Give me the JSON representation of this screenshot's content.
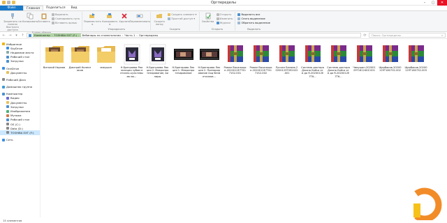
{
  "window": {
    "title": "Оргпеределы"
  },
  "ribbon_tabs": [
    "Файл",
    "Главная",
    "Поделиться",
    "Вид"
  ],
  "ribbon": {
    "clipboard": {
      "label": "Буфер обмена",
      "pin": "Закрепить на панели быстрого доступа",
      "copy": "Копировать",
      "paste": "Вставить",
      "cut": "Вырезать",
      "copy_path": "Скопировать путь",
      "paste_shortcut": "Вставить ярлык"
    },
    "organize": {
      "label": "Упорядочить",
      "move": "Переместить в",
      "copy_to": "Копировать в",
      "delete": "Удалить",
      "rename": "Переименовать"
    },
    "new": {
      "label": "Создать",
      "new_folder": "Создать папку",
      "new_item": "Создать элемент",
      "easy_access": "Простой доступ"
    },
    "open": {
      "label": "Открыть",
      "properties": "Свойства",
      "open": "Открыть",
      "edit": "Изменить",
      "history": "Журнал"
    },
    "select": {
      "label": "Выделить",
      "select_all": "Выделить все",
      "select_none": "Снять выделение",
      "invert": "Обратить выделение"
    }
  },
  "address": {
    "segments": [
      "Компьютер",
      "TOSHIBA EXT (F:)",
      "Вебинары по стоматологии",
      "Часть 1",
      "Оргпеределы"
    ],
    "search_placeholder": "Поиск: Оргпеределы"
  },
  "nav": {
    "items": [
      {
        "label": "Избранное",
        "level": 0,
        "icon": "star-icon"
      },
      {
        "label": "SkyDrive",
        "level": 1,
        "icon": "cloud-icon"
      },
      {
        "label": "Недавние места",
        "level": 1,
        "icon": "recent-icon"
      },
      {
        "label": "Рабочий стол",
        "level": 1,
        "icon": "desktop-icon"
      },
      {
        "label": "Загрузки",
        "level": 1,
        "icon": "download-icon"
      },
      {
        "gap": true
      },
      {
        "label": "OneDrive",
        "level": 0,
        "icon": "cloud-icon"
      },
      {
        "label": "Документы",
        "level": 1,
        "icon": "folder-icon"
      },
      {
        "gap": true
      },
      {
        "label": "Рабочий Диск",
        "level": 0,
        "icon": "drive-icon"
      },
      {
        "gap": true
      },
      {
        "label": "Домашняя группа",
        "level": 0,
        "icon": "homegroup-icon"
      },
      {
        "gap": true
      },
      {
        "label": "Компьютер",
        "level": 0,
        "icon": "computer-icon"
      },
      {
        "label": "Видео",
        "level": 1,
        "icon": "video-icon"
      },
      {
        "label": "Документы",
        "level": 1,
        "icon": "folder-icon"
      },
      {
        "label": "Загрузки",
        "level": 1,
        "icon": "download-icon"
      },
      {
        "label": "Изображения",
        "level": 1,
        "icon": "image-icon"
      },
      {
        "label": "Музыка",
        "level": 1,
        "icon": "music-icon"
      },
      {
        "label": "Рабочий стол",
        "level": 1,
        "icon": "desktop-icon"
      },
      {
        "label": "OS (C:)",
        "level": 1,
        "icon": "drive-icon"
      },
      {
        "label": "Data (D:)",
        "level": 1,
        "icon": "drive-icon"
      },
      {
        "label": "TOSHIBA EXT (F:)",
        "level": 1,
        "icon": "drive-icon",
        "selected": true
      },
      {
        "gap": true
      },
      {
        "label": "Сеть",
        "level": 0,
        "icon": "network-icon"
      }
    ]
  },
  "files": [
    {
      "name": "Виталий Наумов",
      "type": "folder-photo"
    },
    {
      "name": "Дмитрий Колесников",
      "type": "folder-photo"
    },
    {
      "name": "чмеушин",
      "type": "folder"
    },
    {
      "name": "Н.Бреграева Реализация зубов металло-культевыми вк...",
      "type": "mp4"
    },
    {
      "name": "Н.Бреграева Лекция 2. Микропротезирование, виниры",
      "type": "mp4"
    },
    {
      "name": "Н.Брегерова Лекция 1. Микропротезирование",
      "type": "video"
    },
    {
      "name": "Н.Брегерова Лекция 2. Препарирование под безметаллов...",
      "type": "video"
    },
    {
      "name": "Роман Василишин-2020012E7T4171S2-001",
      "type": "rar"
    },
    {
      "name": "Роман Василишин-2020012E7T4171S2-002",
      "type": "rar"
    },
    {
      "name": "Руслан Беляев-20200129T092022-001",
      "type": "rar"
    },
    {
      "name": "Система доктора Джона Койса от А до Я-2020012E7T6...",
      "type": "rar"
    },
    {
      "name": "Система доктора Джона Койса от А до Я-2020012E7T6...",
      "type": "rar"
    },
    {
      "name": "Чмеушин-20200129T161240Z-001",
      "type": "rar"
    },
    {
      "name": "Щербаков-20200129T180732-002",
      "type": "rar"
    },
    {
      "name": "Щербаков-20200129T180732-003",
      "type": "rar"
    }
  ],
  "status": {
    "count": "15 элементов"
  },
  "colors": {
    "accent": "#1979ca",
    "brand_orange": "#f28c28",
    "brand_yellow": "#f6c21a"
  }
}
